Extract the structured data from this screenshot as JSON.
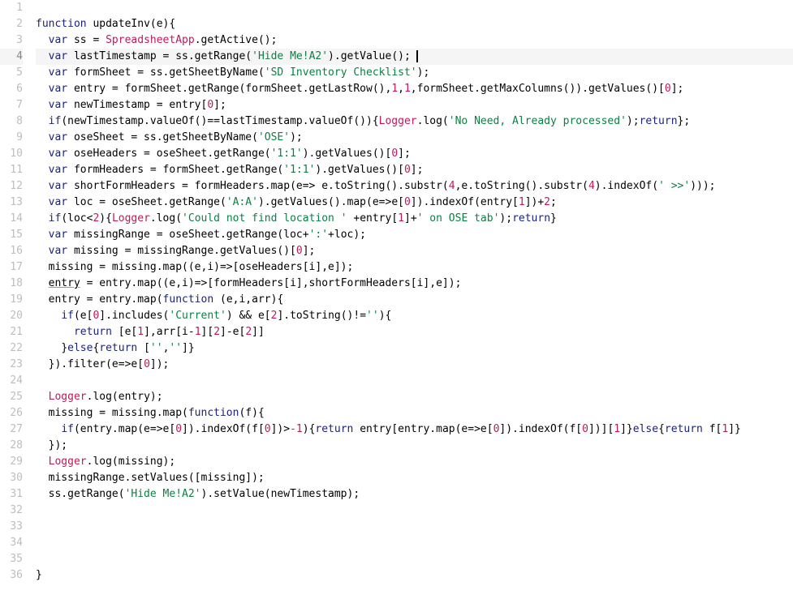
{
  "editor": {
    "cursor_line": 4,
    "lines": [
      {
        "num": 1,
        "indent": 0,
        "tokens": []
      },
      {
        "num": 2,
        "indent": 0,
        "tokens": [
          {
            "t": "kw",
            "v": "function"
          },
          {
            "t": "plain",
            "v": " updateInv(e){"
          }
        ]
      },
      {
        "num": 3,
        "indent": 1,
        "tokens": [
          {
            "t": "kw",
            "v": "var"
          },
          {
            "t": "plain",
            "v": " ss = "
          },
          {
            "t": "type",
            "v": "SpreadsheetApp"
          },
          {
            "t": "plain",
            "v": ".getActive();"
          }
        ]
      },
      {
        "num": 4,
        "indent": 1,
        "tokens": [
          {
            "t": "kw",
            "v": "var"
          },
          {
            "t": "plain",
            "v": " lastTimestamp = ss.getRange("
          },
          {
            "t": "str",
            "v": "'Hide Me!A2'"
          },
          {
            "t": "plain",
            "v": ").getValue();"
          }
        ]
      },
      {
        "num": 5,
        "indent": 1,
        "tokens": [
          {
            "t": "kw",
            "v": "var"
          },
          {
            "t": "plain",
            "v": " formSheet = ss.getSheetByName("
          },
          {
            "t": "str",
            "v": "'SD Inventory Checklist'"
          },
          {
            "t": "plain",
            "v": ");"
          }
        ]
      },
      {
        "num": 6,
        "indent": 1,
        "tokens": [
          {
            "t": "kw",
            "v": "var"
          },
          {
            "t": "plain",
            "v": " entry = formSheet.getRange(formSheet.getLastRow(),"
          },
          {
            "t": "num",
            "v": "1"
          },
          {
            "t": "plain",
            "v": ","
          },
          {
            "t": "num",
            "v": "1"
          },
          {
            "t": "plain",
            "v": ",formSheet.getMaxColumns()).getValues()["
          },
          {
            "t": "num",
            "v": "0"
          },
          {
            "t": "plain",
            "v": "];"
          }
        ]
      },
      {
        "num": 7,
        "indent": 1,
        "tokens": [
          {
            "t": "kw",
            "v": "var"
          },
          {
            "t": "plain",
            "v": " newTimestamp = entry["
          },
          {
            "t": "num",
            "v": "0"
          },
          {
            "t": "plain",
            "v": "];"
          }
        ]
      },
      {
        "num": 8,
        "indent": 1,
        "tokens": [
          {
            "t": "kw",
            "v": "if"
          },
          {
            "t": "plain",
            "v": "(newTimestamp.valueOf()==lastTimestamp.valueOf()){"
          },
          {
            "t": "type",
            "v": "Logger"
          },
          {
            "t": "plain",
            "v": ".log("
          },
          {
            "t": "str",
            "v": "'No Need, Already processed'"
          },
          {
            "t": "plain",
            "v": ");"
          },
          {
            "t": "kw",
            "v": "return"
          },
          {
            "t": "plain",
            "v": "};"
          }
        ]
      },
      {
        "num": 9,
        "indent": 1,
        "tokens": [
          {
            "t": "kw",
            "v": "var"
          },
          {
            "t": "plain",
            "v": " oseSheet = ss.getSheetByName("
          },
          {
            "t": "str",
            "v": "'OSE'"
          },
          {
            "t": "plain",
            "v": ");"
          }
        ]
      },
      {
        "num": 10,
        "indent": 1,
        "tokens": [
          {
            "t": "kw",
            "v": "var"
          },
          {
            "t": "plain",
            "v": " oseHeaders = oseSheet.getRange("
          },
          {
            "t": "str",
            "v": "'1:1'"
          },
          {
            "t": "plain",
            "v": ").getValues()["
          },
          {
            "t": "num",
            "v": "0"
          },
          {
            "t": "plain",
            "v": "];"
          }
        ]
      },
      {
        "num": 11,
        "indent": 1,
        "tokens": [
          {
            "t": "kw",
            "v": "var"
          },
          {
            "t": "plain",
            "v": " formHeaders = formSheet.getRange("
          },
          {
            "t": "str",
            "v": "'1:1'"
          },
          {
            "t": "plain",
            "v": ").getValues()["
          },
          {
            "t": "num",
            "v": "0"
          },
          {
            "t": "plain",
            "v": "];"
          }
        ]
      },
      {
        "num": 12,
        "indent": 1,
        "tokens": [
          {
            "t": "kw",
            "v": "var"
          },
          {
            "t": "plain",
            "v": " shortFormHeaders = formHeaders.map(e=> e.toString().substr("
          },
          {
            "t": "num",
            "v": "4"
          },
          {
            "t": "plain",
            "v": ",e.toString().substr("
          },
          {
            "t": "num",
            "v": "4"
          },
          {
            "t": "plain",
            "v": ").indexOf("
          },
          {
            "t": "str",
            "v": "' >>'"
          },
          {
            "t": "plain",
            "v": ")));"
          }
        ]
      },
      {
        "num": 13,
        "indent": 1,
        "tokens": [
          {
            "t": "kw",
            "v": "var"
          },
          {
            "t": "plain",
            "v": " loc = oseSheet.getRange("
          },
          {
            "t": "str",
            "v": "'A:A'"
          },
          {
            "t": "plain",
            "v": ").getValues().map(e=>e["
          },
          {
            "t": "num",
            "v": "0"
          },
          {
            "t": "plain",
            "v": "]).indexOf(entry["
          },
          {
            "t": "num",
            "v": "1"
          },
          {
            "t": "plain",
            "v": "])+"
          },
          {
            "t": "num",
            "v": "2"
          },
          {
            "t": "plain",
            "v": ";"
          }
        ]
      },
      {
        "num": 14,
        "indent": 1,
        "tokens": [
          {
            "t": "kw",
            "v": "if"
          },
          {
            "t": "plain",
            "v": "(loc<"
          },
          {
            "t": "num",
            "v": "2"
          },
          {
            "t": "plain",
            "v": "){"
          },
          {
            "t": "type",
            "v": "Logger"
          },
          {
            "t": "plain",
            "v": ".log("
          },
          {
            "t": "str",
            "v": "'Could not find location '"
          },
          {
            "t": "plain",
            "v": " +entry["
          },
          {
            "t": "num",
            "v": "1"
          },
          {
            "t": "plain",
            "v": "]+"
          },
          {
            "t": "str",
            "v": "' on OSE tab'"
          },
          {
            "t": "plain",
            "v": ");"
          },
          {
            "t": "kw",
            "v": "return"
          },
          {
            "t": "plain",
            "v": "}"
          }
        ]
      },
      {
        "num": 15,
        "indent": 1,
        "tokens": [
          {
            "t": "kw",
            "v": "var"
          },
          {
            "t": "plain",
            "v": " missingRange = oseSheet.getRange(loc+"
          },
          {
            "t": "str",
            "v": "':'"
          },
          {
            "t": "plain",
            "v": "+loc);"
          }
        ]
      },
      {
        "num": 16,
        "indent": 1,
        "tokens": [
          {
            "t": "kw",
            "v": "var"
          },
          {
            "t": "plain",
            "v": " missing = missingRange.getValues()["
          },
          {
            "t": "num",
            "v": "0"
          },
          {
            "t": "plain",
            "v": "];"
          }
        ]
      },
      {
        "num": 17,
        "indent": 1,
        "tokens": [
          {
            "t": "plain",
            "v": "missing = missing.map((e,i)=>[oseHeaders[i],e]);"
          }
        ]
      },
      {
        "num": 18,
        "indent": 1,
        "tokens": [
          {
            "t": "deprecated",
            "v": "entry"
          },
          {
            "t": "plain",
            "v": " = entry.map((e,i)=>[formHeaders[i],shortFormHeaders[i],e]);"
          }
        ]
      },
      {
        "num": 19,
        "indent": 1,
        "tokens": [
          {
            "t": "plain",
            "v": "entry = entry.map("
          },
          {
            "t": "kw",
            "v": "function"
          },
          {
            "t": "plain",
            "v": " (e,i,arr){"
          }
        ]
      },
      {
        "num": 20,
        "indent": 2,
        "tokens": [
          {
            "t": "kw",
            "v": "if"
          },
          {
            "t": "plain",
            "v": "(e["
          },
          {
            "t": "num",
            "v": "0"
          },
          {
            "t": "plain",
            "v": "].includes("
          },
          {
            "t": "str",
            "v": "'Current'"
          },
          {
            "t": "plain",
            "v": ") && e["
          },
          {
            "t": "num",
            "v": "2"
          },
          {
            "t": "plain",
            "v": "].toString()!="
          },
          {
            "t": "str",
            "v": "''"
          },
          {
            "t": "plain",
            "v": "){"
          }
        ]
      },
      {
        "num": 21,
        "indent": 3,
        "tokens": [
          {
            "t": "kw",
            "v": "return"
          },
          {
            "t": "plain",
            "v": " [e["
          },
          {
            "t": "num",
            "v": "1"
          },
          {
            "t": "plain",
            "v": "],arr[i-"
          },
          {
            "t": "num",
            "v": "1"
          },
          {
            "t": "plain",
            "v": "]["
          },
          {
            "t": "num",
            "v": "2"
          },
          {
            "t": "plain",
            "v": "]-e["
          },
          {
            "t": "num",
            "v": "2"
          },
          {
            "t": "plain",
            "v": "]]"
          }
        ]
      },
      {
        "num": 22,
        "indent": 2,
        "tokens": [
          {
            "t": "plain",
            "v": "}"
          },
          {
            "t": "kw",
            "v": "else"
          },
          {
            "t": "plain",
            "v": "{"
          },
          {
            "t": "kw",
            "v": "return"
          },
          {
            "t": "plain",
            "v": " ["
          },
          {
            "t": "str",
            "v": "''"
          },
          {
            "t": "plain",
            "v": ","
          },
          {
            "t": "str",
            "v": "''"
          },
          {
            "t": "plain",
            "v": "]}"
          }
        ]
      },
      {
        "num": 23,
        "indent": 1,
        "tokens": [
          {
            "t": "plain",
            "v": "}).filter(e=>e["
          },
          {
            "t": "num",
            "v": "0"
          },
          {
            "t": "plain",
            "v": "]);"
          }
        ]
      },
      {
        "num": 24,
        "indent": 0,
        "tokens": []
      },
      {
        "num": 25,
        "indent": 1,
        "tokens": [
          {
            "t": "type",
            "v": "Logger"
          },
          {
            "t": "plain",
            "v": ".log(entry);"
          }
        ]
      },
      {
        "num": 26,
        "indent": 1,
        "tokens": [
          {
            "t": "plain",
            "v": "missing = missing.map("
          },
          {
            "t": "kw",
            "v": "function"
          },
          {
            "t": "plain",
            "v": "(f){"
          }
        ]
      },
      {
        "num": 27,
        "indent": 2,
        "tokens": [
          {
            "t": "kw",
            "v": "if"
          },
          {
            "t": "plain",
            "v": "(entry.map(e=>e["
          },
          {
            "t": "num",
            "v": "0"
          },
          {
            "t": "plain",
            "v": "]).indexOf(f["
          },
          {
            "t": "num",
            "v": "0"
          },
          {
            "t": "plain",
            "v": "])>"
          },
          {
            "t": "num",
            "v": "-1"
          },
          {
            "t": "plain",
            "v": "){"
          },
          {
            "t": "kw",
            "v": "return"
          },
          {
            "t": "plain",
            "v": " entry[entry.map(e=>e["
          },
          {
            "t": "num",
            "v": "0"
          },
          {
            "t": "plain",
            "v": "]).indexOf(f["
          },
          {
            "t": "num",
            "v": "0"
          },
          {
            "t": "plain",
            "v": "])]["
          },
          {
            "t": "num",
            "v": "1"
          },
          {
            "t": "plain",
            "v": "]}"
          },
          {
            "t": "kw",
            "v": "else"
          },
          {
            "t": "plain",
            "v": "{"
          },
          {
            "t": "kw",
            "v": "return"
          },
          {
            "t": "plain",
            "v": " f["
          },
          {
            "t": "num",
            "v": "1"
          },
          {
            "t": "plain",
            "v": "]}"
          }
        ]
      },
      {
        "num": 28,
        "indent": 1,
        "tokens": [
          {
            "t": "plain",
            "v": "});"
          }
        ]
      },
      {
        "num": 29,
        "indent": 1,
        "tokens": [
          {
            "t": "type",
            "v": "Logger"
          },
          {
            "t": "plain",
            "v": ".log(missing);"
          }
        ]
      },
      {
        "num": 30,
        "indent": 1,
        "tokens": [
          {
            "t": "plain",
            "v": "missingRange.setValues([missing]);"
          }
        ]
      },
      {
        "num": 31,
        "indent": 1,
        "tokens": [
          {
            "t": "plain",
            "v": "ss.getRange("
          },
          {
            "t": "str",
            "v": "'Hide Me!A2'"
          },
          {
            "t": "plain",
            "v": ").setValue(newTimestamp);"
          }
        ]
      },
      {
        "num": 32,
        "indent": 0,
        "tokens": []
      },
      {
        "num": 33,
        "indent": 0,
        "tokens": []
      },
      {
        "num": 34,
        "indent": 0,
        "tokens": []
      },
      {
        "num": 35,
        "indent": 0,
        "tokens": []
      },
      {
        "num": 36,
        "indent": 0,
        "tokens": [
          {
            "t": "plain",
            "v": "}"
          }
        ]
      }
    ]
  }
}
